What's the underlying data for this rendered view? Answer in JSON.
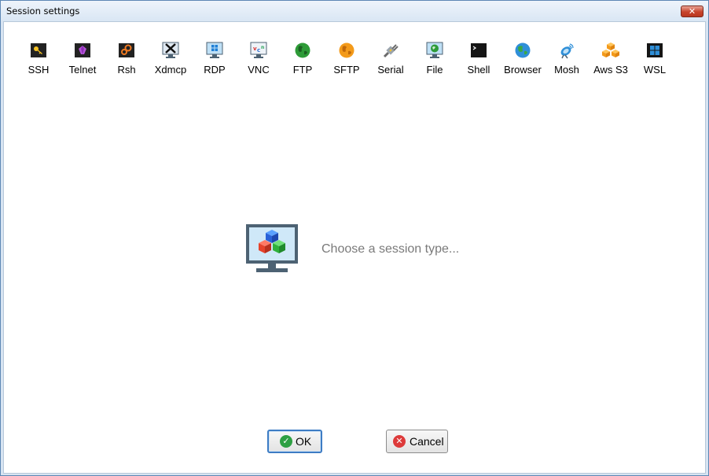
{
  "window": {
    "title": "Session settings",
    "close_glyph": "✕"
  },
  "toolbar": {
    "items": [
      {
        "label": "SSH",
        "icon": "ssh-key-icon"
      },
      {
        "label": "Telnet",
        "icon": "telnet-gem-icon"
      },
      {
        "label": "Rsh",
        "icon": "rsh-gears-icon"
      },
      {
        "label": "Xdmcp",
        "icon": "xdmcp-x-icon"
      },
      {
        "label": "RDP",
        "icon": "rdp-monitor-icon"
      },
      {
        "label": "VNC",
        "icon": "vnc-monitor-icon"
      },
      {
        "label": "FTP",
        "icon": "ftp-globe-icon"
      },
      {
        "label": "SFTP",
        "icon": "sftp-globe-icon"
      },
      {
        "label": "Serial",
        "icon": "serial-plug-icon"
      },
      {
        "label": "File",
        "icon": "file-monitor-icon"
      },
      {
        "label": "Shell",
        "icon": "shell-terminal-icon"
      },
      {
        "label": "Browser",
        "icon": "browser-globe-icon"
      },
      {
        "label": "Mosh",
        "icon": "mosh-satellite-icon"
      },
      {
        "label": "Aws S3",
        "icon": "aws-s3-boxes-icon"
      },
      {
        "label": "WSL",
        "icon": "wsl-windows-icon"
      }
    ]
  },
  "main": {
    "prompt": "Choose a session type..."
  },
  "footer": {
    "ok_label": "OK",
    "cancel_label": "Cancel",
    "ok_glyph": "✓",
    "cancel_glyph": "✕"
  },
  "colors": {
    "accent_blue": "#3d7cc4",
    "ok_green": "#2ea043",
    "cancel_red": "#dd3a3a",
    "prompt_gray": "#7a7a7a"
  }
}
